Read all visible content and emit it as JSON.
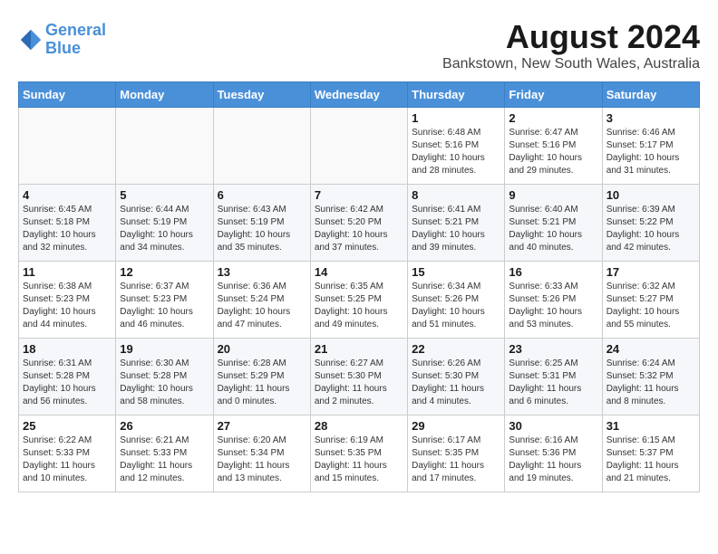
{
  "header": {
    "logo_line1": "General",
    "logo_line2": "Blue",
    "main_title": "August 2024",
    "subtitle": "Bankstown, New South Wales, Australia"
  },
  "days_of_week": [
    "Sunday",
    "Monday",
    "Tuesday",
    "Wednesday",
    "Thursday",
    "Friday",
    "Saturday"
  ],
  "weeks": [
    [
      {
        "day": "",
        "detail": ""
      },
      {
        "day": "",
        "detail": ""
      },
      {
        "day": "",
        "detail": ""
      },
      {
        "day": "",
        "detail": ""
      },
      {
        "day": "1",
        "detail": "Sunrise: 6:48 AM\nSunset: 5:16 PM\nDaylight: 10 hours\nand 28 minutes."
      },
      {
        "day": "2",
        "detail": "Sunrise: 6:47 AM\nSunset: 5:16 PM\nDaylight: 10 hours\nand 29 minutes."
      },
      {
        "day": "3",
        "detail": "Sunrise: 6:46 AM\nSunset: 5:17 PM\nDaylight: 10 hours\nand 31 minutes."
      }
    ],
    [
      {
        "day": "4",
        "detail": "Sunrise: 6:45 AM\nSunset: 5:18 PM\nDaylight: 10 hours\nand 32 minutes."
      },
      {
        "day": "5",
        "detail": "Sunrise: 6:44 AM\nSunset: 5:19 PM\nDaylight: 10 hours\nand 34 minutes."
      },
      {
        "day": "6",
        "detail": "Sunrise: 6:43 AM\nSunset: 5:19 PM\nDaylight: 10 hours\nand 35 minutes."
      },
      {
        "day": "7",
        "detail": "Sunrise: 6:42 AM\nSunset: 5:20 PM\nDaylight: 10 hours\nand 37 minutes."
      },
      {
        "day": "8",
        "detail": "Sunrise: 6:41 AM\nSunset: 5:21 PM\nDaylight: 10 hours\nand 39 minutes."
      },
      {
        "day": "9",
        "detail": "Sunrise: 6:40 AM\nSunset: 5:21 PM\nDaylight: 10 hours\nand 40 minutes."
      },
      {
        "day": "10",
        "detail": "Sunrise: 6:39 AM\nSunset: 5:22 PM\nDaylight: 10 hours\nand 42 minutes."
      }
    ],
    [
      {
        "day": "11",
        "detail": "Sunrise: 6:38 AM\nSunset: 5:23 PM\nDaylight: 10 hours\nand 44 minutes."
      },
      {
        "day": "12",
        "detail": "Sunrise: 6:37 AM\nSunset: 5:23 PM\nDaylight: 10 hours\nand 46 minutes."
      },
      {
        "day": "13",
        "detail": "Sunrise: 6:36 AM\nSunset: 5:24 PM\nDaylight: 10 hours\nand 47 minutes."
      },
      {
        "day": "14",
        "detail": "Sunrise: 6:35 AM\nSunset: 5:25 PM\nDaylight: 10 hours\nand 49 minutes."
      },
      {
        "day": "15",
        "detail": "Sunrise: 6:34 AM\nSunset: 5:26 PM\nDaylight: 10 hours\nand 51 minutes."
      },
      {
        "day": "16",
        "detail": "Sunrise: 6:33 AM\nSunset: 5:26 PM\nDaylight: 10 hours\nand 53 minutes."
      },
      {
        "day": "17",
        "detail": "Sunrise: 6:32 AM\nSunset: 5:27 PM\nDaylight: 10 hours\nand 55 minutes."
      }
    ],
    [
      {
        "day": "18",
        "detail": "Sunrise: 6:31 AM\nSunset: 5:28 PM\nDaylight: 10 hours\nand 56 minutes."
      },
      {
        "day": "19",
        "detail": "Sunrise: 6:30 AM\nSunset: 5:28 PM\nDaylight: 10 hours\nand 58 minutes."
      },
      {
        "day": "20",
        "detail": "Sunrise: 6:28 AM\nSunset: 5:29 PM\nDaylight: 11 hours\nand 0 minutes."
      },
      {
        "day": "21",
        "detail": "Sunrise: 6:27 AM\nSunset: 5:30 PM\nDaylight: 11 hours\nand 2 minutes."
      },
      {
        "day": "22",
        "detail": "Sunrise: 6:26 AM\nSunset: 5:30 PM\nDaylight: 11 hours\nand 4 minutes."
      },
      {
        "day": "23",
        "detail": "Sunrise: 6:25 AM\nSunset: 5:31 PM\nDaylight: 11 hours\nand 6 minutes."
      },
      {
        "day": "24",
        "detail": "Sunrise: 6:24 AM\nSunset: 5:32 PM\nDaylight: 11 hours\nand 8 minutes."
      }
    ],
    [
      {
        "day": "25",
        "detail": "Sunrise: 6:22 AM\nSunset: 5:33 PM\nDaylight: 11 hours\nand 10 minutes."
      },
      {
        "day": "26",
        "detail": "Sunrise: 6:21 AM\nSunset: 5:33 PM\nDaylight: 11 hours\nand 12 minutes."
      },
      {
        "day": "27",
        "detail": "Sunrise: 6:20 AM\nSunset: 5:34 PM\nDaylight: 11 hours\nand 13 minutes."
      },
      {
        "day": "28",
        "detail": "Sunrise: 6:19 AM\nSunset: 5:35 PM\nDaylight: 11 hours\nand 15 minutes."
      },
      {
        "day": "29",
        "detail": "Sunrise: 6:17 AM\nSunset: 5:35 PM\nDaylight: 11 hours\nand 17 minutes."
      },
      {
        "day": "30",
        "detail": "Sunrise: 6:16 AM\nSunset: 5:36 PM\nDaylight: 11 hours\nand 19 minutes."
      },
      {
        "day": "31",
        "detail": "Sunrise: 6:15 AM\nSunset: 5:37 PM\nDaylight: 11 hours\nand 21 minutes."
      }
    ]
  ]
}
